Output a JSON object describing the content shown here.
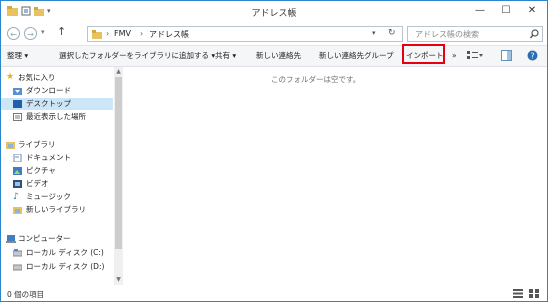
{
  "window": {
    "title": "アドレス帳"
  },
  "address_bar": {
    "crumbs": [
      "FMV",
      "アドレス帳"
    ]
  },
  "search": {
    "placeholder": "アドレス帳の検索"
  },
  "toolbar": {
    "organize": "整理 ▾",
    "add_to_library": "選択したフォルダーをライブラリに追加する ▾",
    "share": "共有 ▾",
    "new_contact": "新しい連絡先",
    "new_contact_group": "新しい連絡先グループ",
    "import": "インポート",
    "more": "»"
  },
  "nav": {
    "favorites": {
      "label": "お気に入り",
      "items": [
        "ダウンロード",
        "デスクトップ",
        "最近表示した場所"
      ]
    },
    "libraries": {
      "label": "ライブラリ",
      "items": [
        "ドキュメント",
        "ピクチャ",
        "ビデオ",
        "ミュージック",
        "新しいライブラリ"
      ]
    },
    "computer": {
      "label": "コンピューター",
      "items": [
        "ローカル ディスク (C:)",
        "ローカル ディスク (D:)"
      ]
    }
  },
  "content": {
    "empty_message": "このフォルダーは空です。"
  },
  "status": {
    "item_count": "0 個の項目"
  },
  "colors": {
    "highlight_box": "#e60012",
    "selection": "#cde6f7",
    "window_border": "#2b87c9"
  }
}
